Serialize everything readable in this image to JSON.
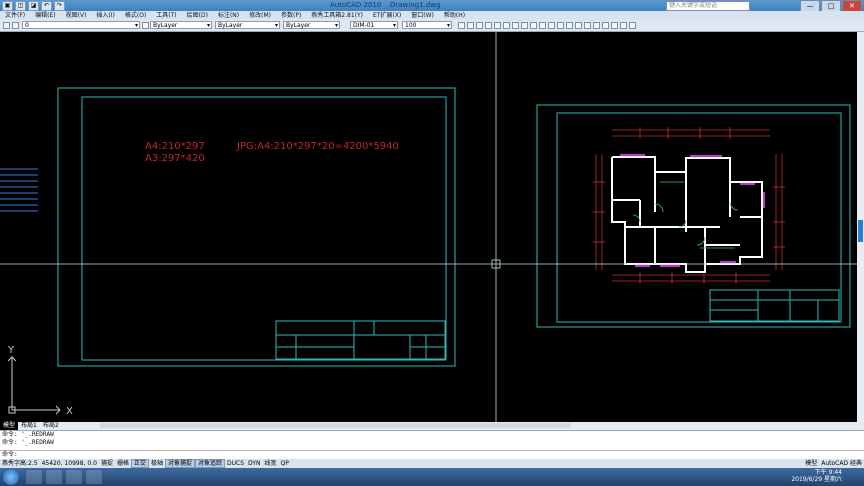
{
  "window": {
    "app_title": "AutoCAD 2010",
    "doc_title": "Drawing1.dwg",
    "search_placeholder": "键入关键字或短语",
    "min_label": "—",
    "max_label": "□",
    "close_label": "✕"
  },
  "quick_access": [
    "▣",
    "◫",
    "◪",
    "↶",
    "↷"
  ],
  "menu": [
    "文件(F)",
    "编辑(E)",
    "视图(V)",
    "插入(I)",
    "格式(O)",
    "工具(T)",
    "绘图(D)",
    "标注(N)",
    "修改(M)",
    "参数(P)",
    "燕秀工具箱2.81(Y)",
    "ET扩展(X)",
    "窗口(W)",
    "帮助(H)"
  ],
  "toolbar": {
    "layer_value": "0",
    "color_value": "ByLayer",
    "linetype_value": "ByLayer",
    "lineweight_value": "ByLayer",
    "dimstyle_value": "DIM-01",
    "scale_value": "100"
  },
  "drawing": {
    "text_a4": "A4:210*297",
    "text_a3": "A3:297*420",
    "text_jpg": "JPG:A4:210*297*20=4200*5940",
    "axis_x": "X",
    "axis_y": "Y",
    "colors": {
      "frame": "#2fb8b8",
      "red_text": "#c0272d",
      "walls": "#ffffff",
      "doors": "#b040c0",
      "dims": "#c03030"
    }
  },
  "tabs": [
    "模型",
    "布局1",
    "布局2"
  ],
  "command": {
    "line1": "命令: '_.REDRAW",
    "line2": "命令: '_.REDRAW",
    "prompt": "命令:"
  },
  "status": {
    "workspace": "燕秀字高:2.5",
    "coords": "45420, 10998, 0.0",
    "toggles": [
      "捕捉",
      "栅格",
      "正交",
      "极轴",
      "对象捕捉",
      "对象追踪",
      "DUCS",
      "DYN",
      "线宽",
      "QP"
    ],
    "right_items": [
      "模型",
      "AutoCAD 经典"
    ]
  },
  "taskbar": {
    "time": "下午 9:44",
    "date": "2019/6/29 星期六"
  }
}
